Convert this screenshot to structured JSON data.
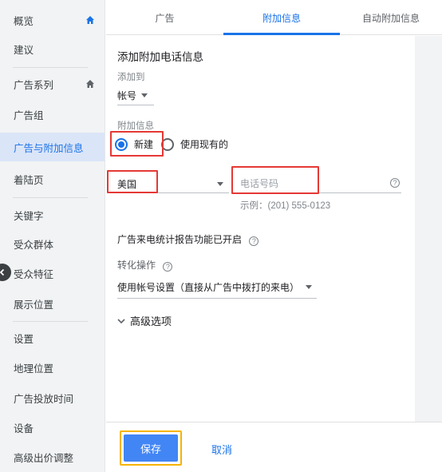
{
  "sidebar": {
    "items": [
      {
        "label": "概览",
        "icon": "home-icon"
      },
      {
        "label": "建议"
      },
      {
        "label": "广告系列",
        "icon": "home-icon"
      },
      {
        "label": "广告组"
      },
      {
        "label": "广告与附加信息",
        "active": true
      },
      {
        "label": "着陆页"
      },
      {
        "label": "关键字"
      },
      {
        "label": "受众群体"
      },
      {
        "label": "受众特征"
      },
      {
        "label": "展示位置"
      },
      {
        "label": "设置"
      },
      {
        "label": "地理位置"
      },
      {
        "label": "广告投放时间"
      },
      {
        "label": "设备"
      },
      {
        "label": "高级出价调整"
      }
    ]
  },
  "tabs": [
    {
      "label": "广告"
    },
    {
      "label": "附加信息",
      "active": true
    },
    {
      "label": "自动附加信息"
    }
  ],
  "form": {
    "title": "添加附加电话信息",
    "add_to_label": "添加到",
    "add_to_value": "帐号",
    "extension_label": "附加信息",
    "radio_new": "新建",
    "radio_existing": "使用现有的",
    "country": "美国",
    "phone_placeholder": "电话号码",
    "example": "示例：(201) 555-0123",
    "report_text": "广告来电统计报告功能已开启",
    "conversion_label": "转化操作",
    "conversion_value": "使用帐号设置（直接从广告中拨打的来电）",
    "advanced": "高级选项"
  },
  "footer": {
    "save": "保存",
    "cancel": "取消"
  },
  "colors": {
    "accent": "#1a73e8",
    "save_button": "#4285f4",
    "highlight_red": "#e53935",
    "highlight_yellow": "#f5b400"
  }
}
